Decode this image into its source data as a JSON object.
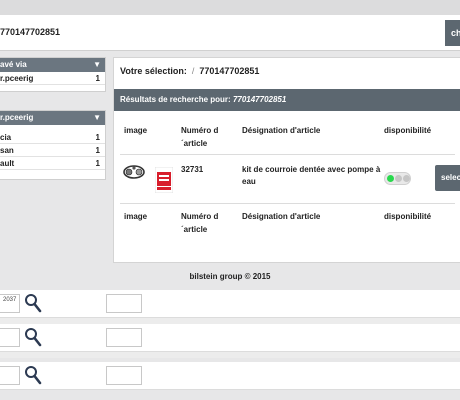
{
  "search": {
    "query_value": "770147702851",
    "button_label": "ch"
  },
  "sidebar": {
    "box1": {
      "header": "avé via",
      "items": [
        {
          "label": "r.pceerig",
          "count": "1"
        }
      ]
    },
    "box2": {
      "header": "r.pceerig",
      "items": [
        {
          "label": "cia",
          "count": "1"
        },
        {
          "label": "san",
          "count": "1"
        },
        {
          "label": "ault",
          "count": "1"
        }
      ]
    }
  },
  "main": {
    "breadcrumb": {
      "label": "Votre sélection:",
      "separator": "/",
      "value": "770147702851"
    },
    "results_bar": {
      "label": "Résultats de recherche pour:",
      "value": "770147702851"
    },
    "columns": {
      "image": "image",
      "article_no": "Numéro d ´article",
      "designation": "Désignation d'article",
      "availability": "disponibilité"
    },
    "row": {
      "article_no": "32731",
      "designation": "kit de courroie dentée avec pompe à eau",
      "select_label": "selec",
      "brand_logo": "febi"
    }
  },
  "footer": {
    "text": "bilstein group © 2015"
  },
  "lower": {
    "row1_input": "2037",
    "icons": [
      "search-icon",
      "search-icon",
      "search-icon"
    ]
  },
  "colors": {
    "accent": "#5c6770",
    "availability_green": "#29d94d",
    "availability_off": "#c6c6c6",
    "brand_red": "#d81e2c"
  }
}
